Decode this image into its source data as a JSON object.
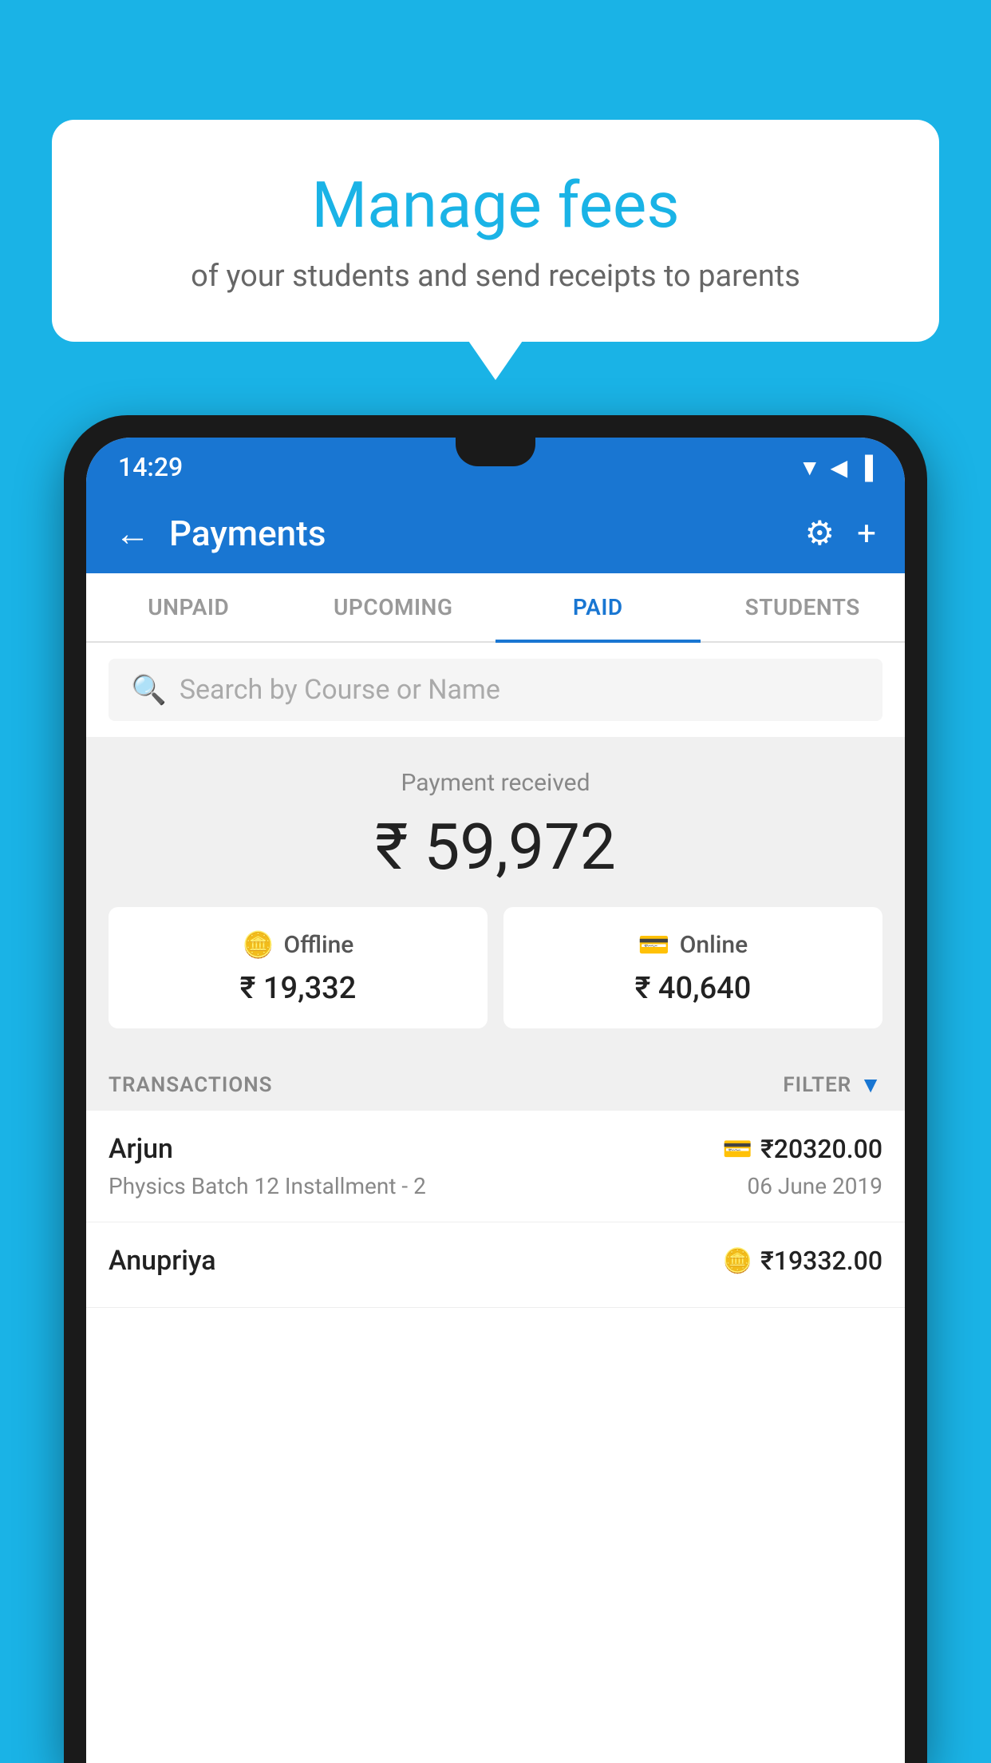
{
  "background_color": "#1ab3e6",
  "bubble": {
    "title": "Manage fees",
    "subtitle": "of your students and send receipts to parents"
  },
  "status_bar": {
    "time": "14:29",
    "wifi": "▲",
    "signal": "▲",
    "battery": "▐"
  },
  "header": {
    "title": "Payments",
    "back_label": "←",
    "settings_label": "⚙",
    "add_label": "+"
  },
  "tabs": [
    {
      "label": "UNPAID",
      "active": false
    },
    {
      "label": "UPCOMING",
      "active": false
    },
    {
      "label": "PAID",
      "active": true
    },
    {
      "label": "STUDENTS",
      "active": false
    }
  ],
  "search": {
    "placeholder": "Search by Course or Name"
  },
  "payment_received": {
    "label": "Payment received",
    "amount": "₹ 59,972",
    "offline": {
      "label": "Offline",
      "amount": "₹ 19,332"
    },
    "online": {
      "label": "Online",
      "amount": "₹ 40,640"
    }
  },
  "transactions": {
    "label": "TRANSACTIONS",
    "filter_label": "FILTER",
    "items": [
      {
        "name": "Arjun",
        "course": "Physics Batch 12 Installment - 2",
        "amount": "₹20320.00",
        "date": "06 June 2019",
        "payment_type": "online"
      },
      {
        "name": "Anupriya",
        "course": "",
        "amount": "₹19332.00",
        "date": "",
        "payment_type": "offline"
      }
    ]
  }
}
